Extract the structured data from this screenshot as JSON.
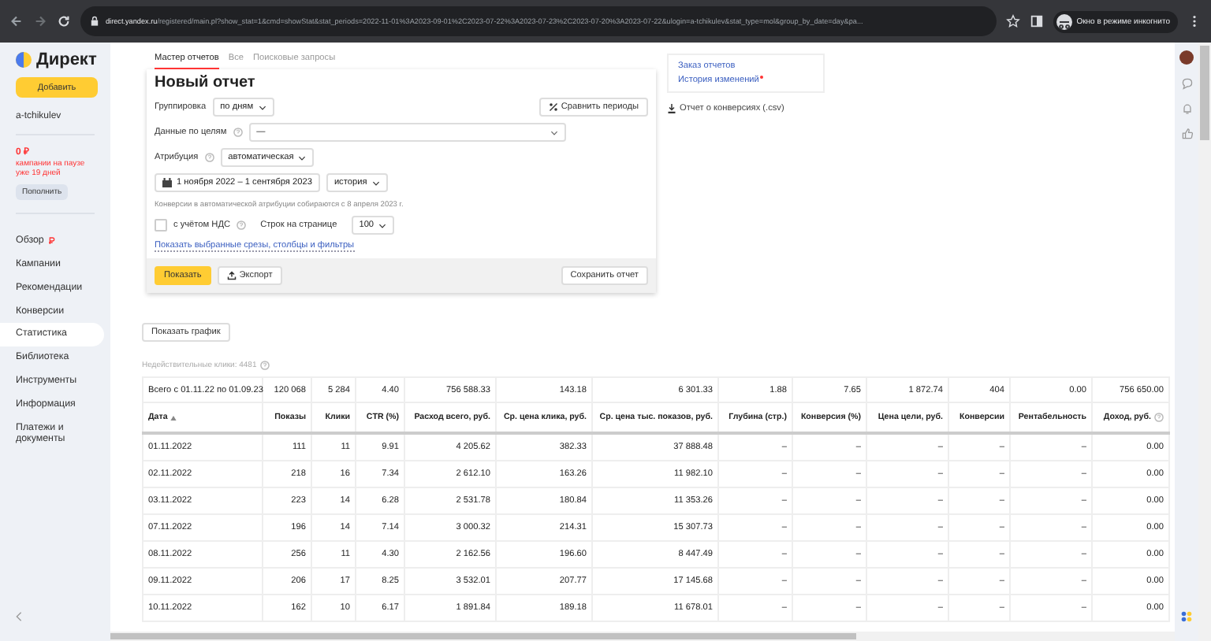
{
  "browser": {
    "url_host": "direct.yandex.ru",
    "url_path": "/registered/main.pl?show_stat=1&cmd=showStat&stat_periods=2022-11-01%3A2023-09-01%2C2023-07-22%3A2023-07-23%2C2023-07-20%3A2023-07-22&ulogin=a-tchikulev&stat_type=mol&group_by_date=day&pa...",
    "incognito_label": "Окно в режиме инкогнито"
  },
  "sidebar": {
    "logo": "Директ",
    "add_button": "Добавить",
    "login": "a-tchikulev",
    "balance": "0 ₽",
    "balance_note": "кампании на паузе уже 19 дней",
    "topup_button": "Пополнить",
    "items": [
      {
        "label": "Обзор",
        "selected": false,
        "alert": true
      },
      {
        "label": "Кампании",
        "selected": false,
        "alert": false
      },
      {
        "label": "Рекомендации",
        "selected": false,
        "alert": false
      },
      {
        "label": "Конверсии",
        "selected": false,
        "alert": false
      },
      {
        "label": "Статистика",
        "selected": true,
        "alert": false
      },
      {
        "label": "Библиотека",
        "selected": false,
        "alert": false
      },
      {
        "label": "Инструменты",
        "selected": false,
        "alert": false
      },
      {
        "label": "Информация",
        "selected": false,
        "alert": false
      },
      {
        "label": "Платежи и документы",
        "selected": false,
        "alert": false
      }
    ]
  },
  "report": {
    "tabs": [
      {
        "label": "Мастер отчетов",
        "selected": true
      },
      {
        "label": "Все",
        "selected": false
      },
      {
        "label": "Поисковые запросы",
        "selected": false
      }
    ],
    "title": "Новый отчет",
    "compare_button": "Сравнить периоды",
    "grouping": {
      "label": "Группировка",
      "value": "по дням"
    },
    "goals": {
      "label": "Данные по целям",
      "value": "—"
    },
    "attribution": {
      "label": "Атрибуция",
      "value": "автоматическая"
    },
    "period": "1 ноября 2022 – 1 сентября 2023",
    "period_mode": "история",
    "attribution_note": "Конверсии в автоматической атрибуции собираются с 8 апреля 2023 г.",
    "vat": {
      "label": "с учётом НДС",
      "checked": false
    },
    "rows_per_page": {
      "label": "Строк на странице",
      "value": "100"
    },
    "slices_link": "Показать выбранные срезы, столбцы и фильтры",
    "show_button": "Показать",
    "export_button": "Экспорт",
    "save_button": "Сохранить отчет"
  },
  "side_links": [
    {
      "label": "Заказ отчетов",
      "new": false
    },
    {
      "label": "История изменений",
      "new": true
    }
  ],
  "csv_link": "Отчет о конверсиях (.csv)",
  "show_chart_button": "Показать график",
  "invalid_clicks": "Недействительные клики: 4481",
  "table": {
    "total_row": [
      "Всего с 01.11.22 по 01.09.23",
      "120 068",
      "5 284",
      "4.40",
      "756 588.33",
      "143.18",
      "6 301.33",
      "1.88",
      "7.65",
      "1 872.74",
      "404",
      "0.00",
      "756 650.00"
    ],
    "columns": [
      {
        "label": "Дата",
        "sorted": true,
        "help": false
      },
      {
        "label": "Показы",
        "sorted": false,
        "help": false
      },
      {
        "label": "Клики",
        "sorted": false,
        "help": false
      },
      {
        "label": "CTR (%)",
        "sorted": false,
        "help": false
      },
      {
        "label": "Расход всего, руб.",
        "sorted": false,
        "help": false
      },
      {
        "label": "Ср. цена клика, руб.",
        "sorted": false,
        "help": false
      },
      {
        "label": "Ср. цена тыс. показов, руб.",
        "sorted": false,
        "help": false
      },
      {
        "label": "Глубина (стр.)",
        "sorted": false,
        "help": false
      },
      {
        "label": "Конверсия (%)",
        "sorted": false,
        "help": false
      },
      {
        "label": "Цена цели, руб.",
        "sorted": false,
        "help": false
      },
      {
        "label": "Конверсии",
        "sorted": false,
        "help": false
      },
      {
        "label": "Рентабельность",
        "sorted": false,
        "help": false
      },
      {
        "label": "Доход, руб.",
        "sorted": false,
        "help": true
      }
    ],
    "rows": [
      [
        "01.11.2022",
        "111",
        "11",
        "9.91",
        "4 205.62",
        "382.33",
        "37 888.48",
        "–",
        "–",
        "–",
        "–",
        "–",
        "0.00"
      ],
      [
        "02.11.2022",
        "218",
        "16",
        "7.34",
        "2 612.10",
        "163.26",
        "11 982.10",
        "–",
        "–",
        "–",
        "–",
        "–",
        "0.00"
      ],
      [
        "03.11.2022",
        "223",
        "14",
        "6.28",
        "2 531.78",
        "180.84",
        "11 353.26",
        "–",
        "–",
        "–",
        "–",
        "–",
        "0.00"
      ],
      [
        "07.11.2022",
        "196",
        "14",
        "7.14",
        "3 000.32",
        "214.31",
        "15 307.73",
        "–",
        "–",
        "–",
        "–",
        "–",
        "0.00"
      ],
      [
        "08.11.2022",
        "256",
        "11",
        "4.30",
        "2 162.56",
        "196.60",
        "8 447.49",
        "–",
        "–",
        "–",
        "–",
        "–",
        "0.00"
      ],
      [
        "09.11.2022",
        "206",
        "17",
        "8.25",
        "3 532.01",
        "207.77",
        "17 145.68",
        "–",
        "–",
        "–",
        "–",
        "–",
        "0.00"
      ],
      [
        "10.11.2022",
        "162",
        "10",
        "6.17",
        "1 891.84",
        "189.18",
        "11 678.01",
        "–",
        "–",
        "–",
        "–",
        "–",
        "0.00"
      ]
    ]
  }
}
